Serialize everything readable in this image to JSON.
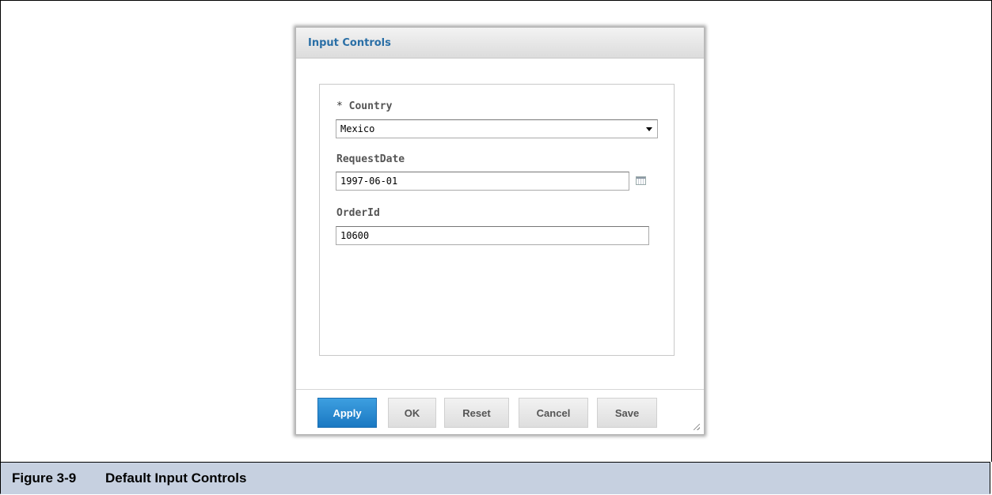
{
  "dialog": {
    "title": "Input Controls"
  },
  "fields": {
    "country": {
      "required_mark": "* ",
      "label": "Country",
      "value": "Mexico"
    },
    "request_date": {
      "label": "RequestDate",
      "value": "1997-06-01"
    },
    "order_id": {
      "label": "OrderId",
      "value": "10600"
    }
  },
  "footer": {
    "apply_label": "Apply",
    "ok_label": "OK",
    "reset_label": "Reset",
    "cancel_label": "Cancel",
    "save_label": "Save"
  },
  "caption": {
    "number": "Figure 3-9",
    "title": "Default Input Controls"
  },
  "icons": {
    "country_dropdown": "chevron-down-icon",
    "request_date_picker": "calendar-icon",
    "resize": "resize-grip-icon"
  },
  "colors": {
    "title": "#2a6fa6",
    "primary_button": "#1a78c2",
    "caption_bar": "#c6d0e0"
  }
}
